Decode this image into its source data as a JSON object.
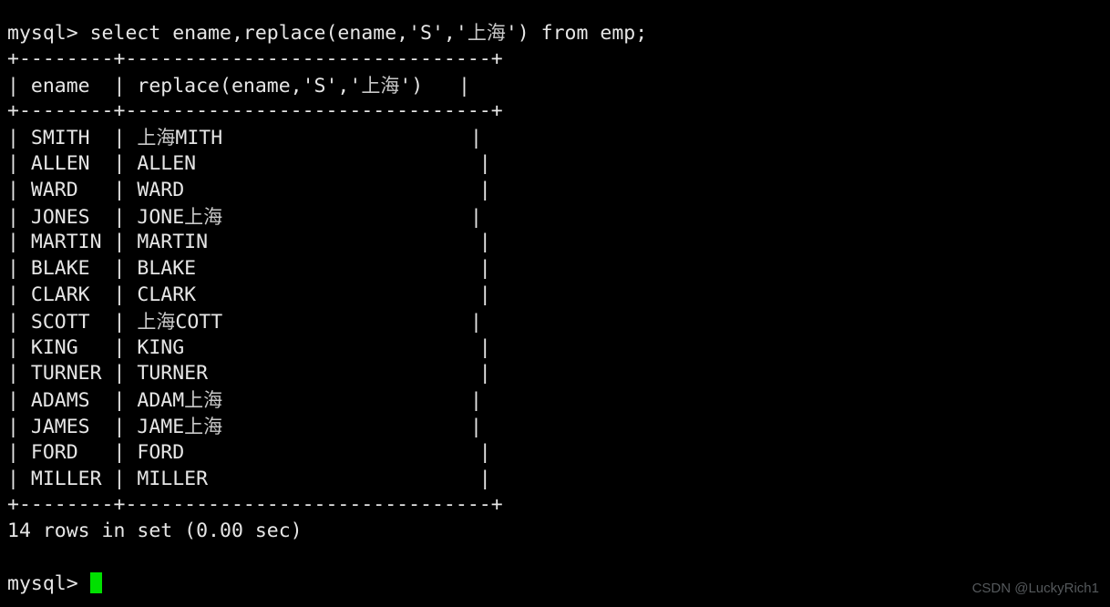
{
  "terminal": {
    "background_color": "#000000",
    "foreground_color": "#e6e6e6",
    "cursor_color": "#00e000",
    "prompt": "mysql>",
    "query": "mysql> select ename,replace(ename,'S','上海') from emp;",
    "query_parts": {
      "before_cjk": "mysql> select ename,replace(ename,'S','",
      "cjk": "上海",
      "after_cjk": "') from emp;"
    },
    "separator": "+--------+-------------------------------+",
    "header_row": {
      "before_cjk": "| ename  | replace(ename,'S','",
      "cjk": "上海",
      "after_cjk": "')   |"
    },
    "columns": [
      "ename",
      "replace(ename,'S','上海')"
    ],
    "rows": [
      {
        "ename": "SMITH",
        "replaced_prefix": "",
        "replaced_cjk": "上海",
        "replaced_suffix": "MITH"
      },
      {
        "ename": "ALLEN",
        "replaced_prefix": "ALLEN",
        "replaced_cjk": "",
        "replaced_suffix": ""
      },
      {
        "ename": "WARD",
        "replaced_prefix": "WARD",
        "replaced_cjk": "",
        "replaced_suffix": ""
      },
      {
        "ename": "JONES",
        "replaced_prefix": "JONE",
        "replaced_cjk": "上海",
        "replaced_suffix": ""
      },
      {
        "ename": "MARTIN",
        "replaced_prefix": "MARTIN",
        "replaced_cjk": "",
        "replaced_suffix": ""
      },
      {
        "ename": "BLAKE",
        "replaced_prefix": "BLAKE",
        "replaced_cjk": "",
        "replaced_suffix": ""
      },
      {
        "ename": "CLARK",
        "replaced_prefix": "CLARK",
        "replaced_cjk": "",
        "replaced_suffix": ""
      },
      {
        "ename": "SCOTT",
        "replaced_prefix": "",
        "replaced_cjk": "上海",
        "replaced_suffix": "COTT"
      },
      {
        "ename": "KING",
        "replaced_prefix": "KING",
        "replaced_cjk": "",
        "replaced_suffix": ""
      },
      {
        "ename": "TURNER",
        "replaced_prefix": "TURNER",
        "replaced_cjk": "",
        "replaced_suffix": ""
      },
      {
        "ename": "ADAMS",
        "replaced_prefix": "ADAM",
        "replaced_cjk": "上海",
        "replaced_suffix": ""
      },
      {
        "ename": "JAMES",
        "replaced_prefix": "JAME",
        "replaced_cjk": "上海",
        "replaced_suffix": ""
      },
      {
        "ename": "FORD",
        "replaced_prefix": "FORD",
        "replaced_cjk": "",
        "replaced_suffix": ""
      },
      {
        "ename": "MILLER",
        "replaced_prefix": "MILLER",
        "replaced_cjk": "",
        "replaced_suffix": ""
      }
    ],
    "result_status": "14 rows in set (0.00 sec)",
    "row_count": 14,
    "elapsed": "0.00 sec"
  },
  "watermark": {
    "text": "CSDN @LuckyRich1"
  }
}
